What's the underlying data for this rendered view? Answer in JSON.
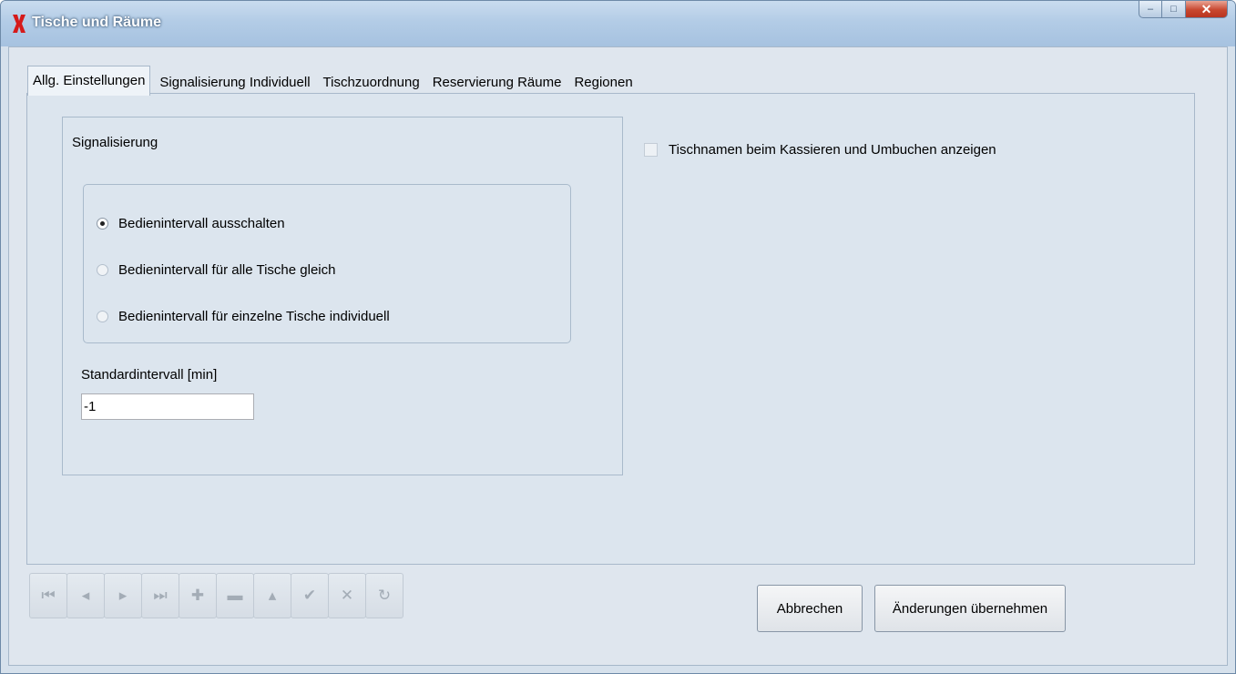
{
  "window": {
    "title": "Tische und Räume",
    "controls": {
      "minimize": "–",
      "maximize": "□",
      "close": "✕"
    }
  },
  "tabs": [
    {
      "label": "Allg. Einstellungen",
      "active": true
    },
    {
      "label": "Signalisierung Individuell",
      "active": false
    },
    {
      "label": "Tischzuordnung",
      "active": false
    },
    {
      "label": "Reservierung Räume",
      "active": false
    },
    {
      "label": "Regionen",
      "active": false
    }
  ],
  "signal_group": {
    "label": "Signalisierung",
    "options": [
      {
        "label": "Bedienintervall ausschalten",
        "selected": true
      },
      {
        "label": "Bedienintervall für alle Tische gleich",
        "selected": false
      },
      {
        "label": "Bedienintervall für einzelne Tische individuell",
        "selected": false
      }
    ],
    "interval_label": "Standardintervall [min]",
    "interval_value": "-1"
  },
  "checkbox": {
    "label": "Tischnamen beim Kassieren und Umbuchen anzeigen",
    "checked": false
  },
  "navigator": {
    "buttons": [
      {
        "name": "first-record-button",
        "icon": "first-icon",
        "glyph": "⏮"
      },
      {
        "name": "prior-record-button",
        "icon": "prior-icon",
        "glyph": "◂"
      },
      {
        "name": "next-record-button",
        "icon": "next-icon",
        "glyph": "▸"
      },
      {
        "name": "last-record-button",
        "icon": "last-icon",
        "glyph": "⏭"
      },
      {
        "name": "insert-record-button",
        "icon": "plus-icon",
        "glyph": "✚"
      },
      {
        "name": "delete-record-button",
        "icon": "minus-icon",
        "glyph": "▬"
      },
      {
        "name": "edit-record-button",
        "icon": "caret-up-icon",
        "glyph": "▴"
      },
      {
        "name": "post-record-button",
        "icon": "check-icon",
        "glyph": "✔"
      },
      {
        "name": "cancel-record-button",
        "icon": "x-icon",
        "glyph": "✕"
      },
      {
        "name": "refresh-record-button",
        "icon": "refresh-icon",
        "glyph": "↻"
      }
    ]
  },
  "buttons": {
    "cancel": "Abbrechen",
    "apply": "Änderungen übernehmen"
  },
  "colors": {
    "titlebar": "#b3cce6",
    "client": "#dfe6ee",
    "close_button": "#c8472f",
    "app_icon": "#d51a1a"
  }
}
